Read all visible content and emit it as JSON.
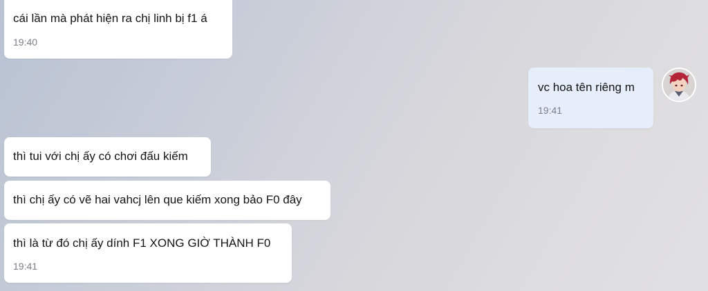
{
  "messages": [
    {
      "direction": "incoming",
      "text": "cái lần mà phát hiện ra chị linh bị f1 á",
      "time": "19:40"
    },
    {
      "direction": "outgoing",
      "text": "vc hoa tên riêng m",
      "time": "19:41"
    },
    {
      "direction": "incoming",
      "text": "thì tui với chị ấy có chơi đấu kiếm",
      "time": ""
    },
    {
      "direction": "incoming",
      "text": "thì chị ấy có vẽ hai vahcj lên que kiếm xong bảo F0 đây",
      "time": ""
    },
    {
      "direction": "incoming",
      "text": "thì là từ đó chị ấy dính F1 XONG GIỜ THÀNH F0",
      "time": "19:41"
    }
  ],
  "avatar": {
    "icon": "user-avatar-anime-red-hair"
  },
  "colors": {
    "incoming_bubble": "#ffffff",
    "outgoing_bubble": "#e6eefc",
    "timestamp": "#7b7e86"
  }
}
